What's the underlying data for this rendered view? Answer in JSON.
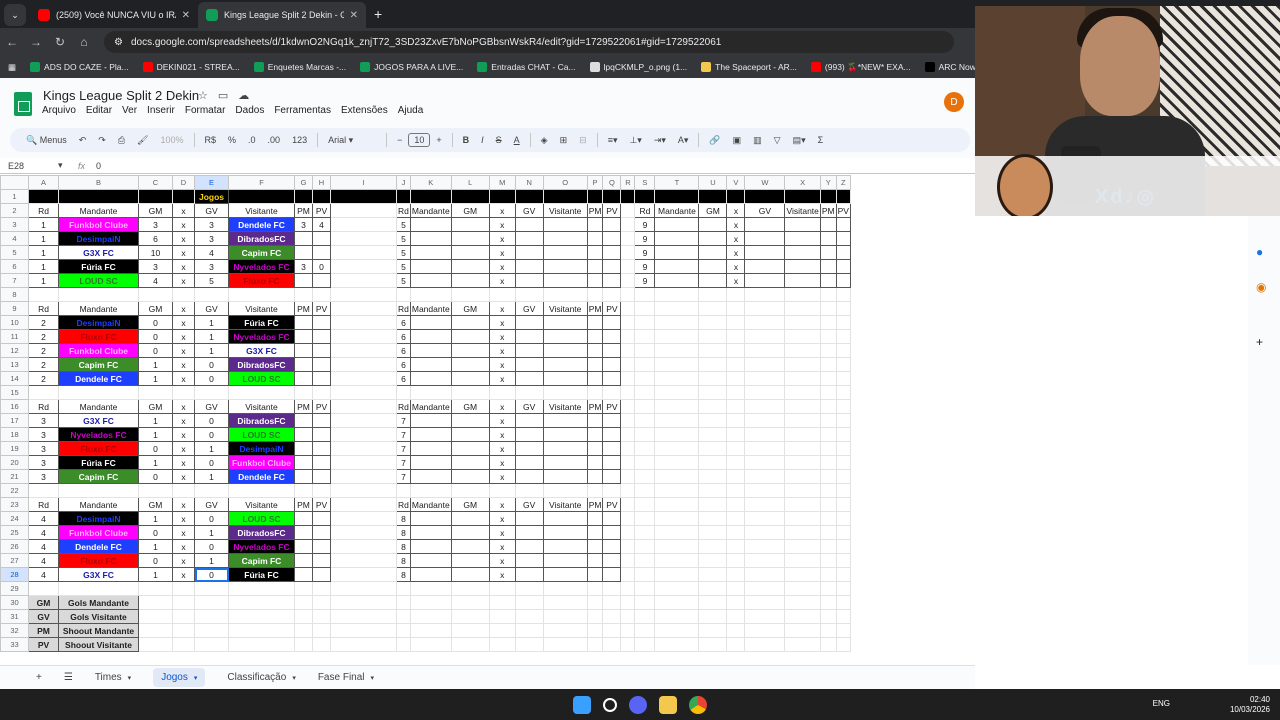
{
  "browser": {
    "tabs": [
      {
        "title": "(2509) Você NUNCA VIU o IRÃ",
        "favicon_color": "#ff0000",
        "active": false
      },
      {
        "title": "Kings League Split 2 Dekin - Go",
        "favicon_color": "#0f9d58",
        "active": true
      }
    ],
    "url": "docs.google.com/spreadsheets/d/1kdwnO2NGq1k_znjT72_3SD23ZxvE7bNoPGBbsnWskR4/edit?gid=1729522061#gid=1729522061",
    "bookmarks": [
      {
        "label": "ADS DO CAZE - Pla...",
        "color": "#0f9d58"
      },
      {
        "label": "DEKIN021 - STREA...",
        "color": "#ff0000"
      },
      {
        "label": "Enquetes Marcas -...",
        "color": "#0f9d58"
      },
      {
        "label": "JOGOS PARA A LIVE...",
        "color": "#0f9d58"
      },
      {
        "label": "Entradas CHAT - Ca...",
        "color": "#0f9d58"
      },
      {
        "label": "lpqCKMLP_o.png (1...",
        "color": "#dddddd"
      },
      {
        "label": "The Spaceport - AR...",
        "color": "#f2c94c"
      },
      {
        "label": "(993) 🍒*NEW* EXA...",
        "color": "#ff0000"
      },
      {
        "label": "ARC Now on X: \"Co...",
        "color": "#000000"
      }
    ]
  },
  "doc": {
    "title": "Kings League Split 2  Dekin",
    "avatar": "D",
    "menus": [
      "Arquivo",
      "Editar",
      "Ver",
      "Inserir",
      "Formatar",
      "Dados",
      "Ferramentas",
      "Extensões",
      "Ajuda"
    ]
  },
  "toolbar": {
    "search": "Menus",
    "zoom": "100%",
    "currency": "R$",
    "percent": "%",
    "dec_less": ".0",
    "dec_more": ".00",
    "number": "123",
    "font": "Arial",
    "font_size": "10"
  },
  "formula": {
    "cell": "E28",
    "fx": "fx",
    "value": "0"
  },
  "columns": [
    "A",
    "B",
    "C",
    "D",
    "E",
    "F",
    "G",
    "H",
    "I",
    "J",
    "K",
    "L",
    "M",
    "N",
    "O",
    "P",
    "Q",
    "R",
    "S",
    "T",
    "U",
    "V",
    "W",
    "X",
    "Y",
    "Z"
  ],
  "title_cell": "Jogos",
  "headers": [
    "Rd",
    "Mandante",
    "GM",
    "x",
    "GV",
    "Visitante",
    "PM",
    "PV"
  ],
  "rounds_left": [
    {
      "header_row": 2,
      "matches": [
        {
          "rd": "1",
          "home": "Funkbol Clube",
          "gm": "3",
          "gv": "3",
          "away": "Dendele FC",
          "pm": "3",
          "pv": "4"
        },
        {
          "rd": "1",
          "home": "DesimpaiN",
          "gm": "6",
          "gv": "3",
          "away": "DibradosFC",
          "pm": "",
          "pv": ""
        },
        {
          "rd": "1",
          "home": "G3X FC",
          "gm": "10",
          "gv": "4",
          "away": "Capim FC",
          "pm": "",
          "pv": ""
        },
        {
          "rd": "1",
          "home": "Fúria FC",
          "gm": "3",
          "gv": "3",
          "away": "Nyvelados FC",
          "pm": "3",
          "pv": "0"
        },
        {
          "rd": "1",
          "home": "LOUD SC",
          "gm": "4",
          "gv": "5",
          "away": "Fluxo FC",
          "pm": "",
          "pv": ""
        }
      ]
    },
    {
      "header_row": 9,
      "matches": [
        {
          "rd": "2",
          "home": "DesimpaiN",
          "gm": "0",
          "gv": "1",
          "away": "Fúria FC",
          "pm": "",
          "pv": ""
        },
        {
          "rd": "2",
          "home": "Fluxo FC",
          "gm": "0",
          "gv": "1",
          "away": "Nyvelados FC",
          "pm": "",
          "pv": ""
        },
        {
          "rd": "2",
          "home": "Funkbol Clube",
          "gm": "0",
          "gv": "1",
          "away": "G3X FC",
          "pm": "",
          "pv": ""
        },
        {
          "rd": "2",
          "home": "Capim FC",
          "gm": "1",
          "gv": "0",
          "away": "DibradosFC",
          "pm": "",
          "pv": ""
        },
        {
          "rd": "2",
          "home": "Dendele FC",
          "gm": "1",
          "gv": "0",
          "away": "LOUD SC",
          "pm": "",
          "pv": ""
        }
      ]
    },
    {
      "header_row": 16,
      "matches": [
        {
          "rd": "3",
          "home": "G3X FC",
          "gm": "1",
          "gv": "0",
          "away": "DibradosFC",
          "pm": "",
          "pv": ""
        },
        {
          "rd": "3",
          "home": "Nyvelados FC",
          "gm": "1",
          "gv": "0",
          "away": "LOUD SC",
          "pm": "",
          "pv": ""
        },
        {
          "rd": "3",
          "home": "Fluxo FC",
          "gm": "0",
          "gv": "1",
          "away": "DesimpaiN",
          "pm": "",
          "pv": ""
        },
        {
          "rd": "3",
          "home": "Fúria FC",
          "gm": "1",
          "gv": "0",
          "away": "Funkbol Clube",
          "pm": "",
          "pv": ""
        },
        {
          "rd": "3",
          "home": "Capim FC",
          "gm": "0",
          "gv": "1",
          "away": "Dendele FC",
          "pm": "",
          "pv": ""
        }
      ]
    },
    {
      "header_row": 23,
      "matches": [
        {
          "rd": "4",
          "home": "DesimpaiN",
          "gm": "1",
          "gv": "0",
          "away": "LOUD SC",
          "pm": "",
          "pv": ""
        },
        {
          "rd": "4",
          "home": "Funkbol Clube",
          "gm": "0",
          "gv": "1",
          "away": "DibradosFC",
          "pm": "",
          "pv": ""
        },
        {
          "rd": "4",
          "home": "Dendele FC",
          "gm": "1",
          "gv": "0",
          "away": "Nyvelados FC",
          "pm": "",
          "pv": ""
        },
        {
          "rd": "4",
          "home": "Fluxo FC",
          "gm": "0",
          "gv": "1",
          "away": "Capim FC",
          "pm": "",
          "pv": ""
        },
        {
          "rd": "4",
          "home": "G3X FC",
          "gm": "1",
          "gv": "0",
          "away": "Fúria FC",
          "pm": "",
          "pv": ""
        }
      ]
    }
  ],
  "rounds_mid": [
    {
      "header_row": 2,
      "rd": "5"
    },
    {
      "header_row": 9,
      "rd": "6"
    },
    {
      "header_row": 16,
      "rd": "7"
    },
    {
      "header_row": 23,
      "rd": "8"
    }
  ],
  "rounds_right": [
    {
      "header_row": 2,
      "rd": "9"
    }
  ],
  "legend": [
    {
      "abbr": "GM",
      "label": "Gols Mandante"
    },
    {
      "abbr": "GV",
      "label": "Gols Visitante"
    },
    {
      "abbr": "PM",
      "label": "Shoout Mandante"
    },
    {
      "abbr": "PV",
      "label": "Shoout Visitante"
    }
  ],
  "team_styles": {
    "Funkbol Clube": {
      "bg": "#ff00ff",
      "fg": "#ffb3ff"
    },
    "DesimpaiN": {
      "bg": "#000000",
      "fg": "#1f3fff"
    },
    "G3X FC": {
      "bg": "#ffffff",
      "fg": "#1a1aa6"
    },
    "Fúria FC": {
      "bg": "#000000",
      "fg": "#ffffff"
    },
    "LOUD SC": {
      "bg": "#00ff00",
      "fg": "#2a7a2a"
    },
    "Dendele FC": {
      "bg": "#1f3fff",
      "fg": "#ffffff"
    },
    "DibradosFC": {
      "bg": "#5b2a8c",
      "fg": "#ffffff"
    },
    "Capim FC": {
      "bg": "#3c8c2a",
      "fg": "#ffffff"
    },
    "Nyvelados FC": {
      "bg": "#000000",
      "fg": "#cc00cc"
    },
    "Fluxo FC": {
      "bg": "#ff0000",
      "fg": "#b30000"
    }
  },
  "sheet_tabs": [
    {
      "label": "Times",
      "active": false
    },
    {
      "label": "Jogos",
      "active": true
    },
    {
      "label": "Classificação",
      "active": false
    },
    {
      "label": "Fase Final",
      "active": false
    }
  ],
  "selected_cell": {
    "row": 28,
    "col": "E"
  },
  "stream_overlay": {
    "text": "Xd♪◎"
  },
  "taskbar": {
    "lang": "ENG",
    "time": "02:40",
    "date": "10/03/2026"
  }
}
